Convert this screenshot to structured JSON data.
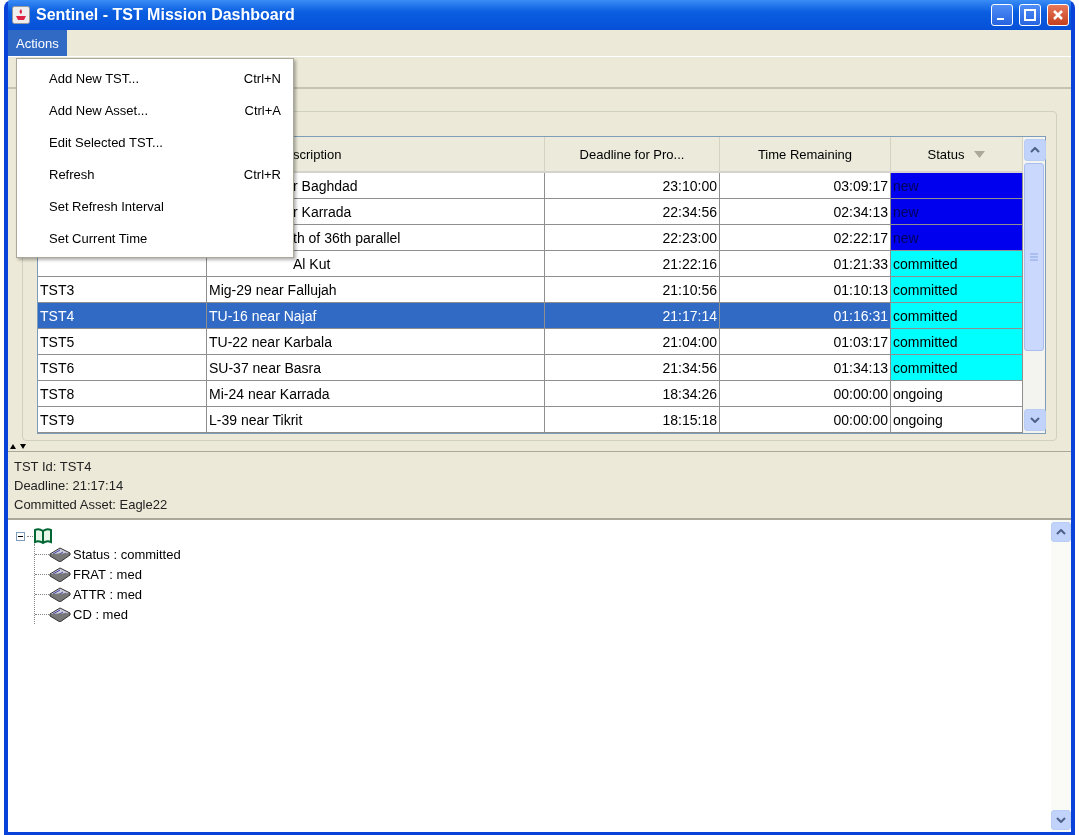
{
  "window": {
    "title": "Sentinel - TST Mission Dashboard"
  },
  "menubar": [
    {
      "label": "Actions",
      "open": true
    }
  ],
  "menu": [
    {
      "label": "Add New TST...",
      "shortcut": "Ctrl+N"
    },
    {
      "label": "Add New Asset...",
      "shortcut": "Ctrl+A"
    },
    {
      "label": "Edit Selected TST..."
    },
    {
      "label": "Refresh",
      "shortcut": "Ctrl+R"
    },
    {
      "label": "Set Refresh Interval"
    },
    {
      "label": "Set Current Time"
    }
  ],
  "table": {
    "columns": [
      {
        "label": "scription"
      },
      {
        "label": "Deadline for Pro..."
      },
      {
        "label": "Time Remaining"
      },
      {
        "label": "Status",
        "sorted": true
      }
    ],
    "rows": [
      {
        "description": "r Baghdad",
        "deadline": "23:10:00",
        "remaining": "03:09:17",
        "status": "new",
        "color": "#0000ee",
        "selected": false
      },
      {
        "description": "r Karrada",
        "deadline": "22:34:56",
        "remaining": "02:34:13",
        "status": "new",
        "color": "#0000ee",
        "selected": false
      },
      {
        "description": "th of 36th parallel",
        "deadline": "22:23:00",
        "remaining": "02:22:17",
        "status": "new",
        "color": "#0000ee",
        "selected": false
      },
      {
        "description": "Al Kut",
        "deadline": "21:22:16",
        "remaining": "01:21:33",
        "status": "committed",
        "color": "#00ffff",
        "selected": false
      },
      {
        "id": "TST3",
        "description": "Mig-29 near Fallujah",
        "deadline": "21:10:56",
        "remaining": "01:10:13",
        "status": "committed",
        "color": "#00ffff",
        "selected": false
      },
      {
        "id": "TST4",
        "description": "TU-16 near Najaf",
        "deadline": "21:17:14",
        "remaining": "01:16:31",
        "status": "committed",
        "color": "#00ffff",
        "selected": true
      },
      {
        "id": "TST5",
        "description": "TU-22 near Karbala",
        "deadline": "21:04:00",
        "remaining": "01:03:17",
        "status": "committed",
        "color": "#00ffff",
        "selected": false
      },
      {
        "id": "TST6",
        "description": "SU-37 near Basra",
        "deadline": "21:34:56",
        "remaining": "01:34:13",
        "status": "committed",
        "color": "#00ffff",
        "selected": false
      },
      {
        "id": "TST8",
        "description": "Mi-24 near Karrada",
        "deadline": "18:34:26",
        "remaining": "00:00:00",
        "status": "ongoing",
        "color": "#ffffff",
        "selected": false
      },
      {
        "id": "TST9",
        "description": "L-39 near Tikrit",
        "deadline": "18:15:18",
        "remaining": "00:00:00",
        "status": "ongoing",
        "color": "#ffffff",
        "selected": false
      }
    ]
  },
  "details": [
    "TST Id:  TST4",
    "Deadline:  21:17:14",
    "Committed Asset:  Eagle22"
  ],
  "tree": {
    "expanded": true,
    "children": [
      {
        "label": "Status : committed"
      },
      {
        "label": "FRAT : med"
      },
      {
        "label": "ATTR : med"
      },
      {
        "label": "CD : med"
      }
    ]
  }
}
